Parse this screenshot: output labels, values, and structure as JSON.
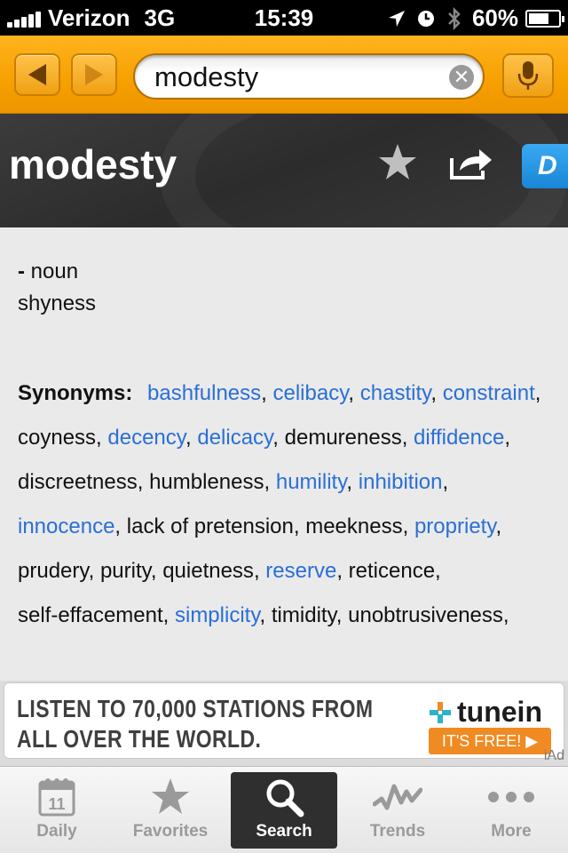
{
  "status_bar": {
    "carrier": "Verizon",
    "network": "3G",
    "time": "15:39",
    "battery": "60%",
    "battery_level": 0.6
  },
  "search": {
    "value": "modesty",
    "placeholder": ""
  },
  "entry": {
    "word": "modesty",
    "dict_badge": "D",
    "part_of_speech_dash": "-",
    "part_of_speech": "noun",
    "definition": "shyness",
    "synonyms_label": "Synonyms:",
    "synonyms": [
      {
        "text": "bashfulness",
        "link": true
      },
      {
        "text": "celibacy",
        "link": true
      },
      {
        "text": "chastity",
        "link": true
      },
      {
        "text": "constraint",
        "link": true
      },
      {
        "text": "coyness",
        "link": false
      },
      {
        "text": "decency",
        "link": true
      },
      {
        "text": "delicacy",
        "link": true
      },
      {
        "text": "demureness",
        "link": false
      },
      {
        "text": "diffidence",
        "link": true
      },
      {
        "text": "discreetness",
        "link": false
      },
      {
        "text": "humbleness",
        "link": false
      },
      {
        "text": "humility",
        "link": true
      },
      {
        "text": "inhibition",
        "link": true
      },
      {
        "text": "innocence",
        "link": true
      },
      {
        "text": "lack of pretension",
        "link": false
      },
      {
        "text": "meekness",
        "link": false
      },
      {
        "text": "propriety",
        "link": true
      },
      {
        "text": "prudery",
        "link": false
      },
      {
        "text": "purity",
        "link": false
      },
      {
        "text": "quietness",
        "link": false
      },
      {
        "text": "reserve",
        "link": true
      },
      {
        "text": "reticence",
        "link": false
      },
      {
        "text": "self-effacement",
        "link": false
      },
      {
        "text": "simplicity",
        "link": true
      },
      {
        "text": "timidity",
        "link": false
      },
      {
        "text": "unobtrusiveness",
        "link": false
      }
    ]
  },
  "ad": {
    "line1": "LISTEN TO 70,000 STATIONS FROM",
    "line2": "ALL OVER THE WORLD.",
    "brand": "tunein",
    "cta": "IT'S FREE! ▶",
    "iad": "iAd"
  },
  "tabs": [
    {
      "label": "Daily",
      "icon": "calendar-icon",
      "calendar_day": "11"
    },
    {
      "label": "Favorites",
      "icon": "star-icon"
    },
    {
      "label": "Search",
      "icon": "magnifier-icon"
    },
    {
      "label": "Trends",
      "icon": "trends-wave-icon"
    },
    {
      "label": "More",
      "icon": "more-dots-icon"
    }
  ],
  "colors": {
    "header_orange": "#f6a000",
    "link_blue": "#2a6fd6",
    "word_header_dark": "#333333",
    "tunein_orange": "#f08a22"
  }
}
